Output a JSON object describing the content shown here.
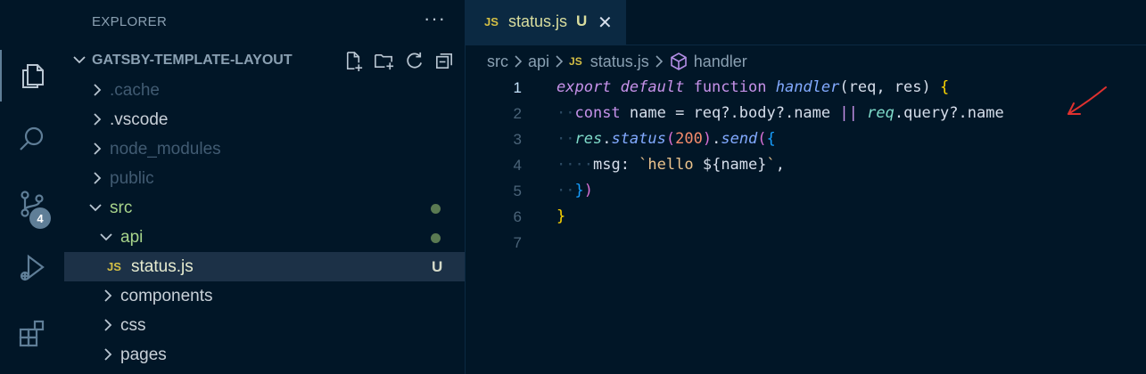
{
  "colors": {
    "background": "#011627",
    "accent": "#c792ea",
    "selection": "#1c3147",
    "annotation": "#e0312f"
  },
  "activity_bar": {
    "items": [
      {
        "icon": "files-icon",
        "active": true
      },
      {
        "icon": "search-icon"
      },
      {
        "icon": "source-control-icon",
        "badge": "4"
      },
      {
        "icon": "run-debug-icon"
      },
      {
        "icon": "extensions-icon"
      }
    ]
  },
  "sidebar": {
    "title": "EXPLORER",
    "more": "···",
    "folder": "GATSBY-TEMPLATE-LAYOUT",
    "tree": [
      {
        "label": ".cache"
      },
      {
        "label": ".vscode"
      },
      {
        "label": "node_modules"
      },
      {
        "label": "public"
      },
      {
        "label": "src"
      },
      {
        "label": "api"
      },
      {
        "label": "status.js",
        "icon_text": "JS",
        "status": "U"
      },
      {
        "label": "components"
      },
      {
        "label": "css"
      },
      {
        "label": "pages"
      }
    ]
  },
  "tab": {
    "icon_text": "JS",
    "name": "status.js",
    "status": "U",
    "close": "✕"
  },
  "breadcrumb": {
    "items": [
      "src",
      "api",
      "status.js",
      "handler"
    ],
    "file_icon_text": "JS"
  },
  "editor": {
    "line_numbers": [
      "1",
      "2",
      "3",
      "4",
      "5",
      "6",
      "7"
    ],
    "tokens": {
      "l1_export": "export",
      "l1_default": "default",
      "l1_function": "function",
      "l1_name": "handler",
      "l1_open": "(",
      "l1_args": "req, res",
      "l1_close": ")",
      "l1_brace": "{",
      "l2_const": "const",
      "l2_rest1": " name = req",
      "l2_q1": "?.",
      "l2_body": "body",
      "l2_q2": "?.",
      "l2_name1": "name ",
      "l2_or": "||",
      "l2_req": "req",
      "l2_dot": ".",
      "l2_query": "query",
      "l2_q3": "?.",
      "l2_name2": "name",
      "l3_res": "res",
      "l3_dot": ".",
      "l3_status": "status",
      "l3_p1": "(",
      "l3_num": "200",
      "l3_p2": ")",
      "l3_dot2": ".",
      "l3_send": "send",
      "l3_p3": "(",
      "l3_b": "{",
      "l4_key": "msg",
      "l4_colon": ": ",
      "l4_str1": "`hello ",
      "l4_tpl_open": "${",
      "l4_tpl_var": "name",
      "l4_tpl_close": "}",
      "l4_str2": "`",
      "l4_comma": ",",
      "l5_b": "}",
      "l5_p": ")",
      "l6_b": "}"
    }
  }
}
